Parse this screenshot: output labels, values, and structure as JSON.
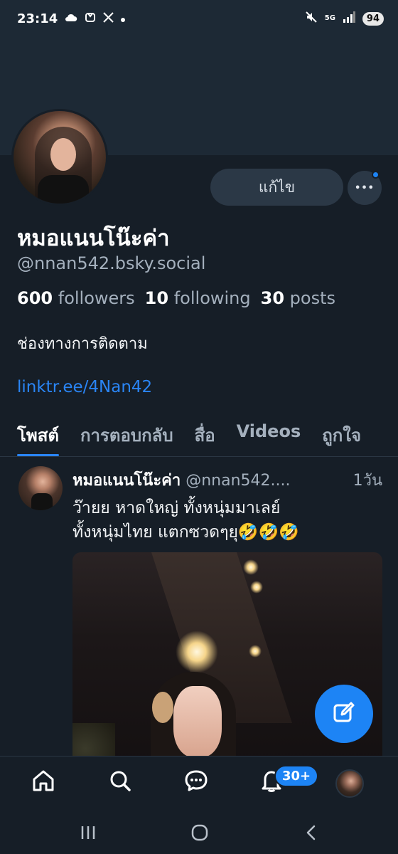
{
  "status_bar": {
    "time": "23:14",
    "left_icons": [
      "cloud-icon",
      "mi-icon",
      "x-logo-icon",
      "dot-icon"
    ],
    "right_icons": [
      "mute-icon",
      "5g-icon",
      "signal-icon"
    ],
    "network": "5G",
    "battery": "94"
  },
  "profile": {
    "edit_button": "แก้ไข",
    "more_button": "•••",
    "display_name": "หมอแนนโน๊ะค่า",
    "handle": "@nnan542.bsky.social",
    "stats": {
      "followers_count": "600",
      "followers_label": "followers",
      "following_count": "10",
      "following_label": "following",
      "posts_count": "30",
      "posts_label": "posts"
    },
    "bio": "ช่องทางการติดตาม",
    "link": "linktr.ee/4Nan42"
  },
  "tabs": [
    {
      "label": "โพสต์",
      "active": true
    },
    {
      "label": "การตอบกลับ",
      "active": false
    },
    {
      "label": "สื่อ",
      "active": false
    },
    {
      "label": "Videos",
      "active": false
    },
    {
      "label": "ถูกใจ",
      "active": false
    }
  ],
  "post": {
    "author": "หมอแนนโน๊ะค่า",
    "handle": "@nnan542....",
    "time": "1วัน",
    "text_line1": "ว๊ายย หาดใหญ่ ทั้งหนุ่มมาเลย์",
    "text_line2": "ทั้งหนุ่มไทย แตกซวดๆยุ🤣🤣🤣"
  },
  "fab_icon": "compose-icon",
  "bottom_nav": {
    "items": [
      "home-icon",
      "search-icon",
      "chat-icon",
      "bell-icon",
      "avatar"
    ],
    "notif_badge": "30+"
  },
  "colors": {
    "background": "#161e27",
    "banner": "#1d2935",
    "accent": "#1d84f5",
    "link": "#2a85f5",
    "muted_text": "#a4b0bd",
    "button_bg": "#2b3846"
  }
}
